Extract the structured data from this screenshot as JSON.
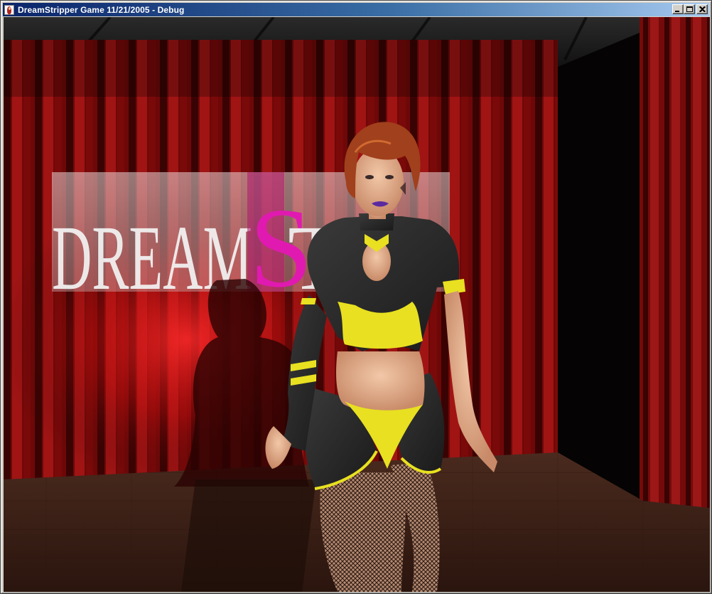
{
  "window": {
    "title": "DreamStripper Game 11/21/2005 - Debug",
    "icon": "app-portrait-icon",
    "controls": {
      "minimize_icon": "minimize-icon",
      "maximize_icon": "maximize-icon",
      "close_icon": "close-icon"
    }
  },
  "scene": {
    "sign_text": {
      "part1": "DREAM",
      "part2": "S",
      "part3": "TR"
    },
    "colors": {
      "curtain_red": "#8a0a0a",
      "floor_brown": "#3d2218",
      "sign_magenta": "#d01aa0",
      "outfit_black": "#2a2a2a",
      "outfit_yellow": "#e8e020",
      "hair_auburn": "#a0401c",
      "title_bar_blue": "#0a246a"
    }
  }
}
